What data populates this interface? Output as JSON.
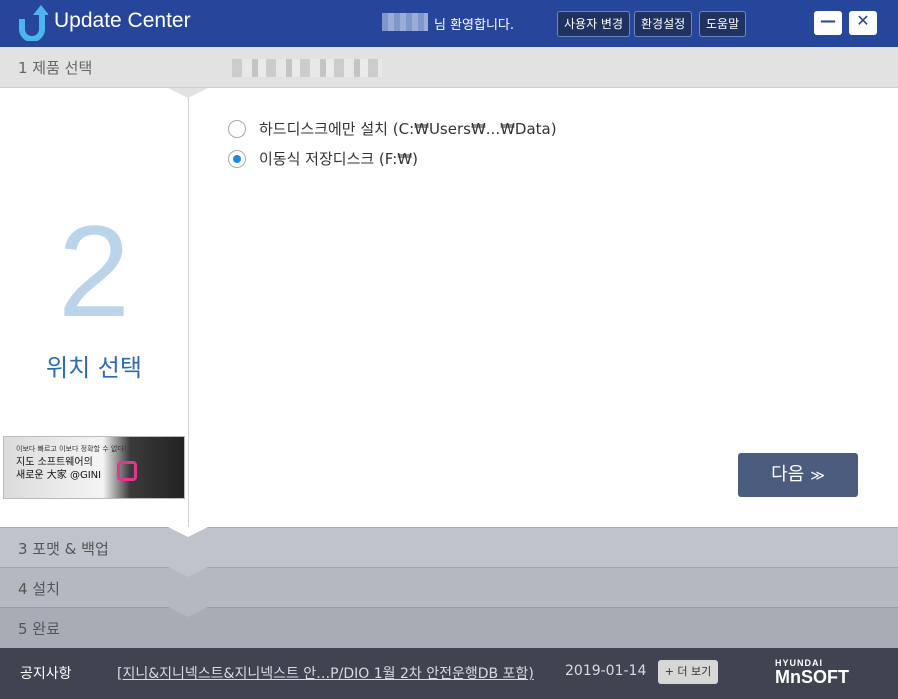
{
  "titlebar": {
    "app_title": "Update Center",
    "welcome": "님 환영합니다.",
    "buttons": {
      "change_user": "사용자 변경",
      "settings": "환경설정",
      "help": "도움말"
    },
    "minimize_label": "—",
    "close_label": "✕"
  },
  "steps": {
    "s1": "1  제품 선택",
    "s3": "3  포맷 & 백업",
    "s4": "4  설치",
    "s5": "5  완료"
  },
  "current_step": {
    "number": "2",
    "label": "위치 선택"
  },
  "banner": {
    "line1": "이보다 빠르고 이보다 정확할 수 없다!",
    "line2": "지도 소프트웨어의",
    "line3": "새로운 大家 @GINI"
  },
  "options": [
    {
      "label": "하드디스크에만 설치 (C:₩Users₩...₩Data)",
      "selected": false
    },
    {
      "label": "이동식 저장디스크 (F:₩)",
      "selected": true
    }
  ],
  "next_button": {
    "label": "다음",
    "chevron": "≫"
  },
  "footer": {
    "notice_label": "공지사항",
    "notice_text": "[지니&지니넥스트&지니넥스트 안…P/DIO 1월 2차 안전운행DB 포함)",
    "date": "2019-01-14",
    "more_label": "+ 더 보기",
    "brand_top": "HYUNDAI",
    "brand_bottom": "MnSOFT"
  },
  "colors": {
    "titlebar": "#26469b",
    "accent": "#2b6cb2",
    "next_button": "#4c5c7e",
    "footer": "#3f4450"
  },
  "icons": {
    "logo": "update-arrow-logo-icon",
    "radio": "radio-icon",
    "chevron": "double-chevron-down-icon"
  }
}
